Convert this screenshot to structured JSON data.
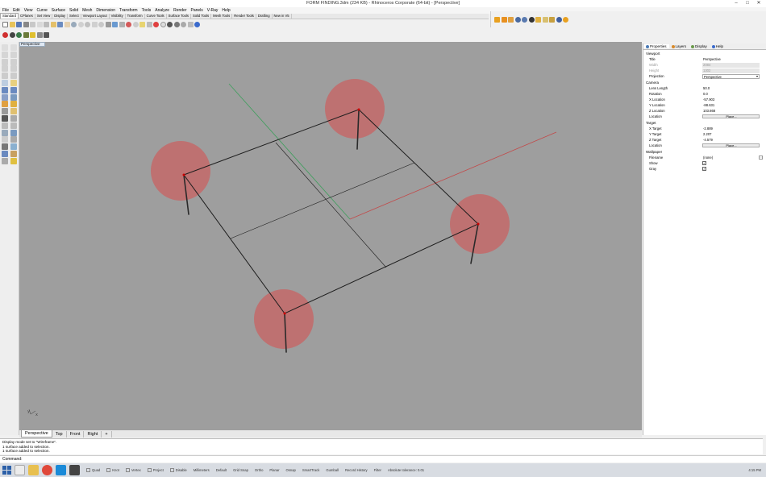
{
  "window": {
    "title": "FORM FINDING.3dm (234 KB) - Rhinoceros Corporate (64-bit) - [Perspective]",
    "minimize": "–",
    "maximize": "□",
    "close": "✕"
  },
  "menu": [
    "File",
    "Edit",
    "View",
    "Curve",
    "Surface",
    "Solid",
    "Mesh",
    "Dimension",
    "Transform",
    "Tools",
    "Analyze",
    "Render",
    "Panels",
    "V-Ray",
    "Help"
  ],
  "toolbar_tabs": [
    "Standard",
    "CPlanes",
    "Set View",
    "Display",
    "Select",
    "Viewport Layout",
    "Visibility",
    "Transform",
    "Curve Tools",
    "Surface Tools",
    "Solid Tools",
    "Mesh Tools",
    "Render Tools",
    "Drafting",
    "New in V5"
  ],
  "viewport": {
    "active_label": "Perspective",
    "tabs": [
      "Perspective",
      "Top",
      "Front",
      "Right"
    ],
    "add_tab": "+",
    "axis_labels": {
      "x": "x",
      "y": "y"
    }
  },
  "panel": {
    "tabs": [
      "Properties",
      "Layers",
      "Display",
      "Help"
    ],
    "tab_colors": [
      "#4a7ab5",
      "#d88a2a",
      "#6a9a4a",
      "#3a6acc"
    ],
    "sections": {
      "viewport": "Viewport",
      "camera": "Camera",
      "target": "Target",
      "wallpaper": "Wallpaper"
    },
    "viewport_rows": [
      {
        "label": "Title",
        "value": "Perspective"
      },
      {
        "label": "Width",
        "value": "2084"
      },
      {
        "label": "Height",
        "value": "1302"
      },
      {
        "label": "Projection",
        "value": "Perspective"
      }
    ],
    "camera_rows": [
      {
        "label": "Lens Length",
        "value": "50.0"
      },
      {
        "label": "Rotation",
        "value": "0.0"
      },
      {
        "label": "X Location",
        "value": "-57.903"
      },
      {
        "label": "Y Location",
        "value": "-88.631"
      },
      {
        "label": "Z Location",
        "value": "103.868"
      },
      {
        "label": "Location",
        "value": "Place..."
      }
    ],
    "target_rows": [
      {
        "label": "X Target",
        "value": "-2.889"
      },
      {
        "label": "Y Target",
        "value": "2.207"
      },
      {
        "label": "Z Target",
        "value": "-4.579"
      },
      {
        "label": "Location",
        "value": "Place..."
      }
    ],
    "wallpaper_rows": [
      {
        "label": "Filename",
        "value": "(none)"
      },
      {
        "label": "Show",
        "value": "✓"
      },
      {
        "label": "Gray",
        "value": "✓"
      }
    ]
  },
  "command_history": [
    "Display mode set to \"Wireframe\".",
    "1 surface added to selection.",
    "1 surface added to selection."
  ],
  "command_prompt": "Command:",
  "status": {
    "osnaps": [
      "Quad",
      "Knot",
      "Vertex",
      "Project",
      "Disable"
    ],
    "layer": "Default",
    "units": "Millimeters",
    "toggles": [
      "Grid Snap",
      "Ortho",
      "Planar",
      "Osnap",
      "SmartTrack",
      "Gumball",
      "Record History",
      "Filter"
    ],
    "tolerance": "Absolute tolerance: 0.01",
    "time": "4:15 PM"
  },
  "colors": {
    "viewport_bg": "#9e9e9e",
    "sphere_fill": "#c36868",
    "x_axis": "#c24a4a",
    "y_axis": "#3e9e5c"
  }
}
